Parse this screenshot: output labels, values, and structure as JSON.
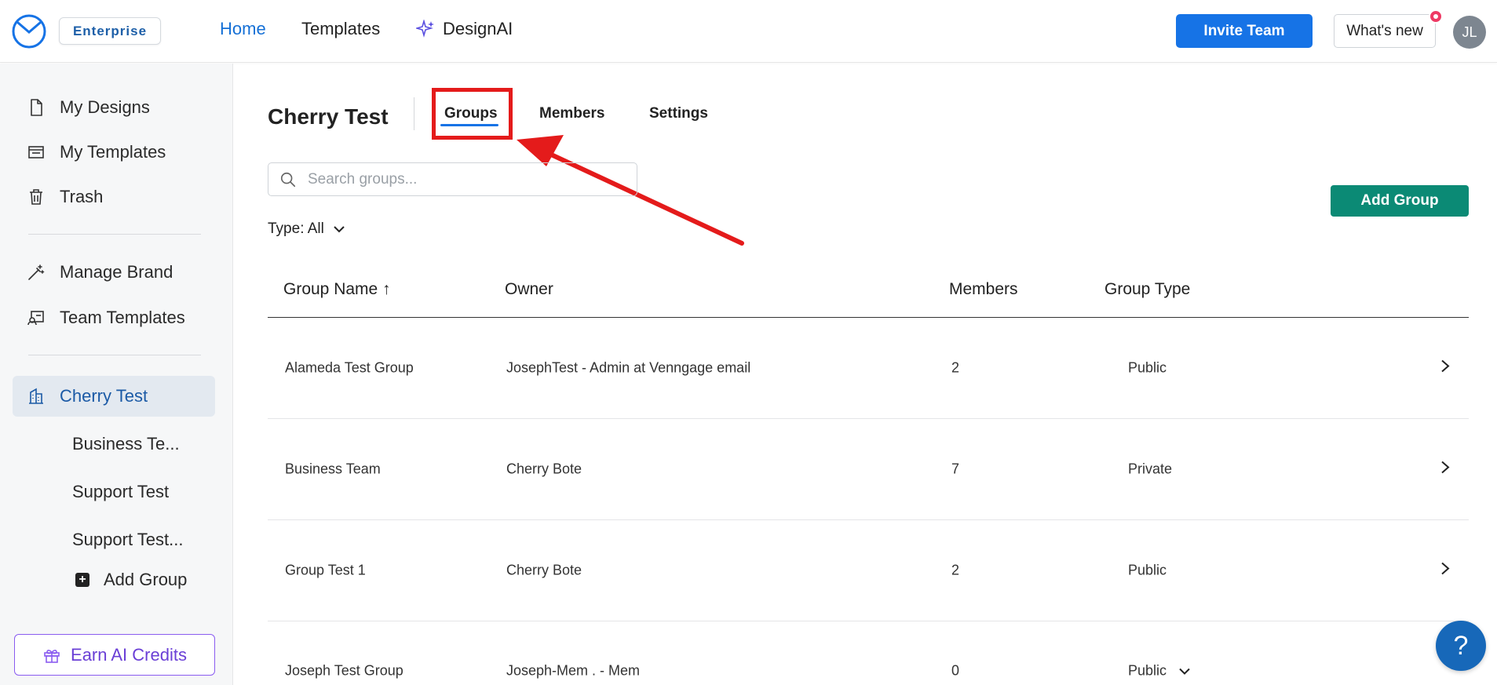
{
  "header": {
    "plan_badge": "Enterprise",
    "nav": {
      "home": "Home",
      "templates": "Templates",
      "designai": "DesignAI"
    },
    "invite_button": "Invite Team",
    "whats_new_button": "What's new",
    "avatar_initials": "JL"
  },
  "sidebar": {
    "items": [
      {
        "label": "My Designs",
        "icon": "file-icon"
      },
      {
        "label": "My Templates",
        "icon": "templates-icon"
      },
      {
        "label": "Trash",
        "icon": "trash-icon"
      },
      {
        "label": "Manage Brand",
        "icon": "magic-wand-icon"
      },
      {
        "label": "Team Templates",
        "icon": "team-templates-icon"
      },
      {
        "label": "Cherry Test",
        "icon": "building-icon"
      }
    ],
    "sub_items": [
      "Business Te...",
      "Support Test",
      "Support Test..."
    ],
    "add_group": "Add Group",
    "earn_credits": "Earn AI Credits"
  },
  "main": {
    "title": "Cherry Test",
    "tabs": {
      "groups": "Groups",
      "members": "Members",
      "settings": "Settings"
    },
    "search_placeholder": "Search groups...",
    "type_filter": "Type: All",
    "add_group_button": "Add Group",
    "table": {
      "headers": {
        "name": "Group Name ↑",
        "owner": "Owner",
        "members": "Members",
        "type": "Group Type"
      },
      "rows": [
        {
          "name": "Alameda Test Group",
          "owner": "JosephTest - Admin at Venngage email",
          "members": "2",
          "type": "Public"
        },
        {
          "name": "Business Team",
          "owner": "Cherry Bote",
          "members": "7",
          "type": "Private"
        },
        {
          "name": "Group Test 1",
          "owner": "Cherry Bote",
          "members": "2",
          "type": "Public"
        },
        {
          "name": "Joseph Test Group",
          "owner": "Joseph-Mem . - Mem",
          "members": "0",
          "type": "Public"
        }
      ]
    }
  },
  "help_label": "?",
  "colors": {
    "primary": "#1673e6",
    "add_group": "#0b8a75",
    "annotation_red": "#e41b1b",
    "earn_purple": "#8a5cf0"
  }
}
